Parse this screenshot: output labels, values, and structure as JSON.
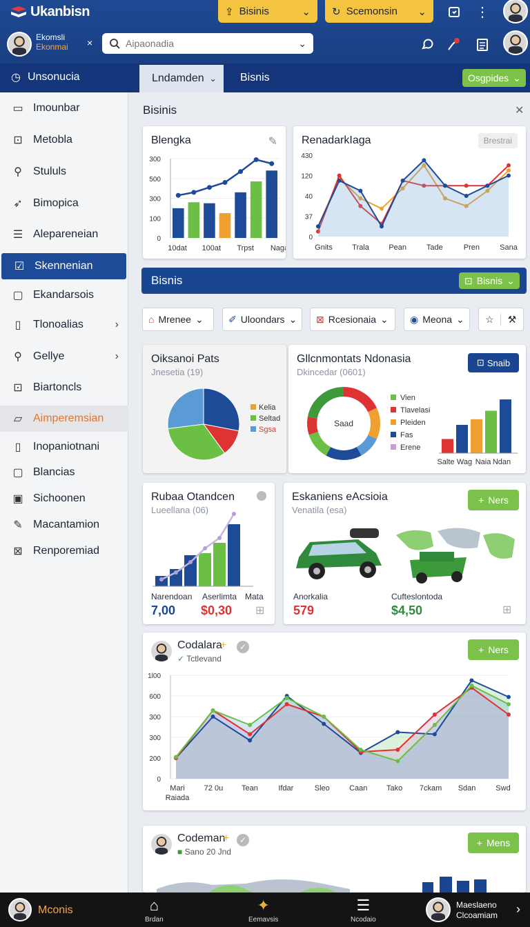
{
  "app": {
    "title": "Ukanbisn"
  },
  "topbar": {
    "btn1_label": "Bisinis",
    "btn2_label": "Scemonsin"
  },
  "user": {
    "name": "Ekomsli",
    "subtitle": "Ekonmai"
  },
  "search": {
    "placeholder": "Aipaonadia"
  },
  "nav": {
    "left_label": "Unsonucia",
    "tab_active": "Lndamden",
    "tab_other": "Bisnis",
    "right_button": "Osgpides"
  },
  "sidebar": {
    "items": [
      {
        "label": "Imounbar",
        "icon": "note-icon"
      },
      {
        "label": "Metobla",
        "icon": "bag-icon"
      },
      {
        "label": "Stululs",
        "icon": "user-icon"
      },
      {
        "label": "Bimopica",
        "icon": "send-icon"
      },
      {
        "label": "Alepareneian",
        "icon": "list-icon"
      },
      {
        "label": "Skennenian",
        "icon": "check-square-icon"
      },
      {
        "label": "Ekandarsois",
        "icon": "chat-icon"
      },
      {
        "label": "Tlonoalias",
        "icon": "doc-icon"
      },
      {
        "label": "Gellye",
        "icon": "search-icon"
      },
      {
        "label": "Biartoncls",
        "icon": "bag-icon"
      },
      {
        "label": "Aimperemsian",
        "icon": "folder-icon"
      },
      {
        "label": "Inopaniotnani",
        "icon": "doc-icon"
      },
      {
        "label": "Blancias",
        "icon": "chat-icon"
      },
      {
        "label": "Sichoonen",
        "icon": "square-icon"
      },
      {
        "label": "Macantamion",
        "icon": "pencil-icon"
      },
      {
        "label": "Renporemiad",
        "icon": "k-box-icon"
      }
    ]
  },
  "main": {
    "title": "Bisinis"
  },
  "card1": {
    "title": "Blengka"
  },
  "card2": {
    "title": "RenadarkIaga",
    "badge": "Brestrai"
  },
  "bluebar": {
    "title": "Bisnis",
    "button": "Bisnis"
  },
  "filters": {
    "f1": "Mrenee",
    "f2": "Uloondars",
    "f3": "Rcesionaia",
    "f4": "Meona"
  },
  "card3": {
    "title": "Oiksanoi Pats",
    "subtitle": "Jnesetia (19)",
    "legend": [
      "Kelia",
      "Seltad",
      "Sgsa"
    ]
  },
  "card4": {
    "title": "Gllcnmontats Ndonasia",
    "subtitle": "Dkincedar (0601)",
    "button": "Snaib",
    "center": "Saad",
    "legend": [
      "Vien",
      "Tlavelasi",
      "Pleiden",
      "Fas",
      "Erene"
    ],
    "bar_labels": [
      "Salte",
      "Wag",
      "Naia",
      "Ndan"
    ]
  },
  "card5": {
    "title": "Rubaa Otandcen",
    "subtitle": "Lueellana (06)",
    "labels": [
      "Narendoan",
      "Aserlimta",
      "Mata"
    ],
    "value1": "7,00",
    "value2": "$0,30"
  },
  "card6": {
    "title": "Eskaniens eAcsioia",
    "subtitle": "Venatila (esa)",
    "button": "Ners",
    "label1": "Anorkalia",
    "label2": "Cufteslontoda",
    "value1": "579",
    "value2": "$4,50"
  },
  "card7": {
    "title": "Codalara",
    "subtitle": "Tctlevand",
    "button": "Ners",
    "xlabels": [
      "Mari",
      "72 0u",
      "Tean",
      "Ifdar",
      "Sleo",
      "Caan",
      "Tako",
      "7ckam",
      "Sdan",
      "Swd"
    ],
    "xlabel_extra": "Raiada",
    "yticks": [
      "1l00",
      "600",
      "300",
      "300",
      "200",
      "0"
    ]
  },
  "card8": {
    "title": "Codeman",
    "subtitle": "Sano 20 Jnd",
    "button": "Mens"
  },
  "bottombar": {
    "brand": "Mconis",
    "items": [
      "Brdan",
      "Eemavsis",
      "Ncodaio"
    ],
    "user_line1": "Maeslaeno",
    "user_line2": "Clcoamiam"
  },
  "chart_data": [
    {
      "type": "bar",
      "title": "Blengka",
      "categories": [
        "10dat",
        "100at",
        "Trpst",
        "Naga"
      ],
      "yticks": [
        "300",
        "500",
        "300",
        "100",
        "0"
      ],
      "values": [
        150,
        180,
        175,
        125,
        230,
        285,
        340
      ],
      "line": [
        215,
        230,
        255,
        280,
        335,
        395,
        375
      ]
    },
    {
      "type": "line",
      "title": "RenadarkIaga",
      "categories": [
        "Gnits",
        "Trala",
        "Pean",
        "Tade",
        "Pren",
        "Sana"
      ],
      "yticks": [
        "430",
        "120",
        "40",
        "37",
        "0"
      ],
      "series": [
        {
          "values": [
            20,
            115,
            75,
            55,
            95,
            140,
            75,
            60,
            90,
            130
          ]
        },
        {
          "values": [
            10,
            120,
            60,
            25,
            110,
            100,
            100,
            100,
            100,
            140
          ]
        },
        {
          "values": [
            20,
            110,
            90,
            20,
            110,
            150,
            100,
            80,
            100,
            120
          ]
        }
      ]
    },
    {
      "type": "pie",
      "title": "Oiksanoi Pats",
      "labels": [
        "Kelia",
        "Seltad",
        "Sgsa"
      ],
      "values": [
        28,
        12,
        33,
        27
      ]
    },
    {
      "type": "bar",
      "title": "Gllcnmontats Ndonasia",
      "categories": [
        "Salte",
        "Wag",
        "Naia",
        "Ndan"
      ],
      "values": [
        25,
        50,
        60,
        75,
        95
      ]
    },
    {
      "type": "bar",
      "title": "Rubaa Otandcen",
      "categories": [
        "Narendoan",
        "Aserlimta",
        "Mata"
      ],
      "values": [
        15,
        25,
        45,
        48,
        63,
        90
      ],
      "line": [
        10,
        20,
        35,
        55,
        70,
        105
      ]
    },
    {
      "type": "area",
      "title": "Codalara",
      "categories": [
        "Mari",
        "72 0u",
        "Tean",
        "Ifdar",
        "Sleo",
        "Caan",
        "Tako",
        "7ckam",
        "Sdan",
        "Swd"
      ],
      "series": [
        {
          "values": [
            200,
            600,
            370,
            800,
            530,
            250,
            450,
            430,
            950,
            790
          ]
        },
        {
          "values": [
            200,
            660,
            430,
            720,
            600,
            260,
            280,
            620,
            880,
            620
          ]
        },
        {
          "values": [
            210,
            660,
            520,
            780,
            600,
            280,
            170,
            520,
            900,
            720
          ]
        }
      ]
    }
  ]
}
